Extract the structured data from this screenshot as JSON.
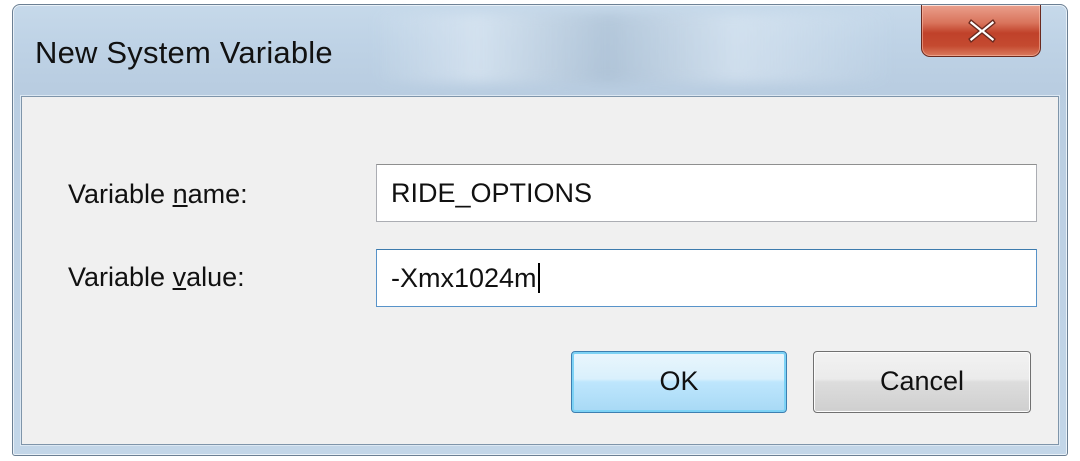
{
  "window": {
    "title": "New System Variable"
  },
  "titlebar": {
    "close_icon": "close-icon"
  },
  "form": {
    "name_label_prefix": "Variable ",
    "name_label_accel": "n",
    "name_label_suffix": "ame:",
    "name_value": "RIDE_OPTIONS",
    "value_label_prefix": "Variable ",
    "value_label_accel": "v",
    "value_label_suffix": "alue:",
    "value_value": "-Xmx1024m"
  },
  "buttons": {
    "ok_label": "OK",
    "cancel_label": "Cancel"
  },
  "colors": {
    "close_button": "#c0412a",
    "focused_field_border": "#5893c9",
    "default_button_border": "#3c7fb1"
  }
}
